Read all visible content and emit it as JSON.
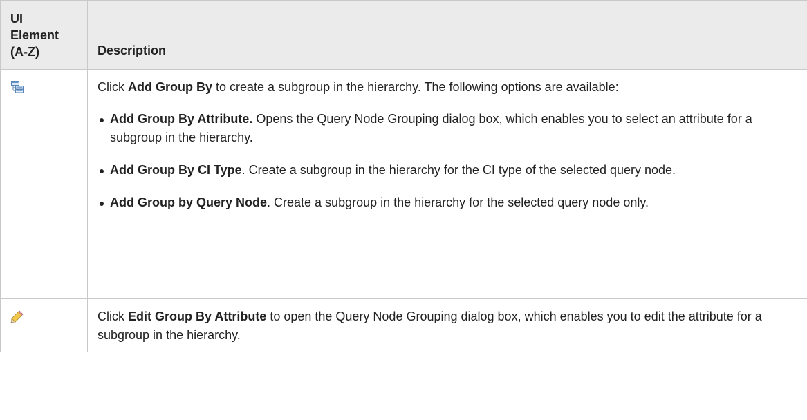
{
  "table": {
    "header": {
      "element_lines": [
        "UI",
        "Element",
        "(A-Z)"
      ],
      "description": "Description"
    },
    "rows": [
      {
        "icon": "add-group-by-icon",
        "intro": {
          "pre": "Click ",
          "bold": "Add Group By",
          "post": " to create a subgroup in the hierarchy. The following options are available:"
        },
        "options": [
          {
            "bold": "Add Group By Attribute.",
            "text": " Opens the Query Node Grouping dialog box, which enables you to select an attribute for a subgroup in the hierarchy."
          },
          {
            "bold": "Add Group By CI Type",
            "text": ". Create a subgroup in the hierarchy for the CI type of the selected query node."
          },
          {
            "bold": "Add Group by Query Node",
            "text": ". Create a subgroup in the hierarchy for the selected query node only."
          }
        ]
      },
      {
        "icon": "pencil-edit-icon",
        "intro": {
          "pre": "Click ",
          "bold": "Edit Group By Attribute",
          "post": " to open the Query Node Grouping dialog box, which enables you to edit the attribute for a subgroup in the hierarchy."
        }
      }
    ]
  }
}
